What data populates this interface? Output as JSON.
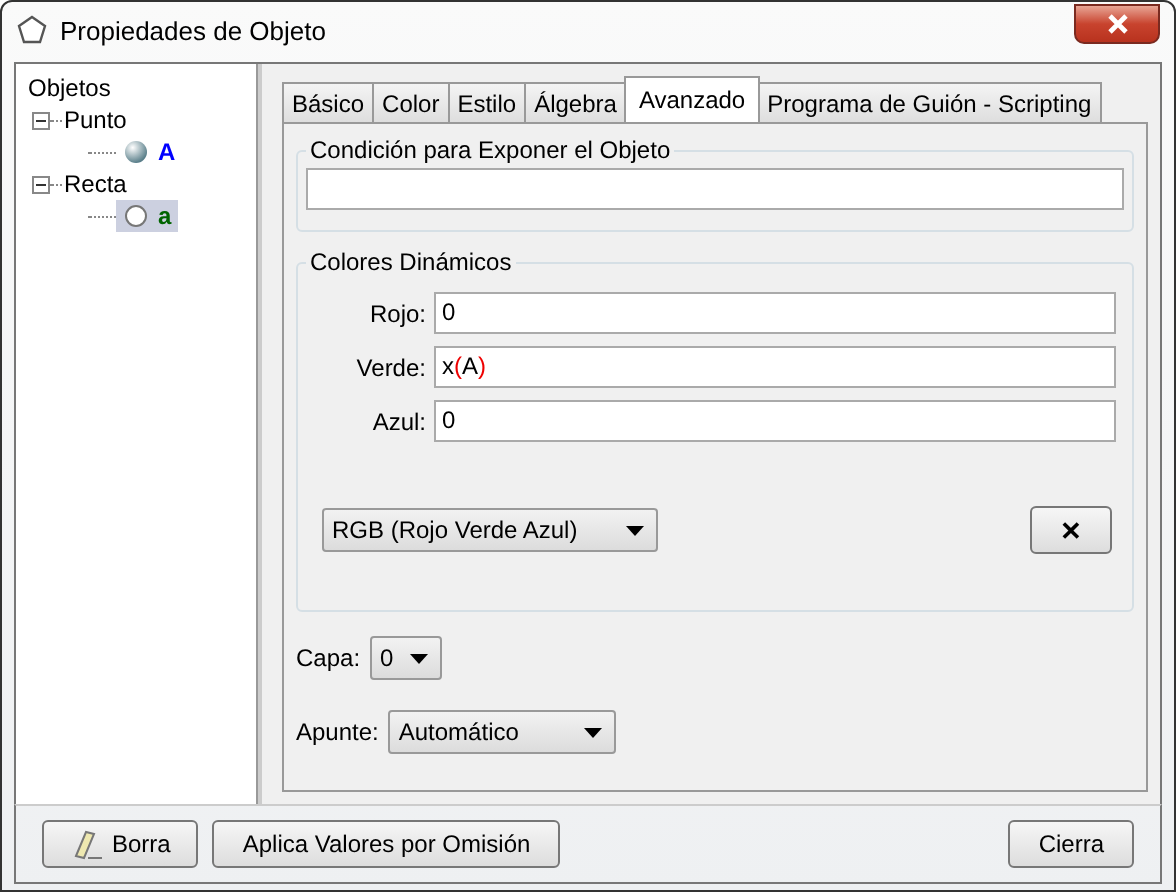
{
  "window": {
    "title": "Propiedades de Objeto"
  },
  "tree": {
    "label": "Objetos",
    "children": [
      {
        "label": "Punto",
        "expanded": true,
        "children": [
          {
            "label": "A",
            "kind": "point",
            "color": "#0000ff",
            "selected": false
          }
        ]
      },
      {
        "label": "Recta",
        "expanded": true,
        "children": [
          {
            "label": "a",
            "kind": "line",
            "color": "#006400",
            "selected": true
          }
        ]
      }
    ]
  },
  "tabs": [
    {
      "label": "Básico",
      "selected": false
    },
    {
      "label": "Color",
      "selected": false
    },
    {
      "label": "Estilo",
      "selected": false
    },
    {
      "label": "Álgebra",
      "selected": false
    },
    {
      "label": "Avanzado",
      "selected": true
    },
    {
      "label": "Programa de Guión - Scripting",
      "selected": false
    }
  ],
  "condition": {
    "title": "Condición para Exponer el Objeto"
  },
  "dynamic_colors": {
    "title": "Colores Dinámicos",
    "fields": [
      {
        "label": "Rojo:",
        "value": [
          {
            "text": "0",
            "kind": "plain"
          }
        ]
      },
      {
        "label": "Verde:",
        "value": [
          {
            "text": "x",
            "kind": "plain"
          },
          {
            "text": "(",
            "kind": "bracket"
          },
          {
            "text": "A",
            "kind": "plain"
          },
          {
            "text": ")",
            "kind": "bracket"
          }
        ]
      },
      {
        "label": "Azul:",
        "value": [
          {
            "text": "0",
            "kind": "plain"
          }
        ]
      }
    ],
    "mode": "RGB (Rojo Verde Azul)",
    "clear_button": "✕"
  },
  "layer": {
    "label": "Capa:",
    "value": "0"
  },
  "tooltip": {
    "label": "Apunte:",
    "value": "Automático"
  },
  "buttons": {
    "delete": "Borra",
    "defaults": "Aplica Valores por Omisión",
    "close": "Cierra"
  }
}
